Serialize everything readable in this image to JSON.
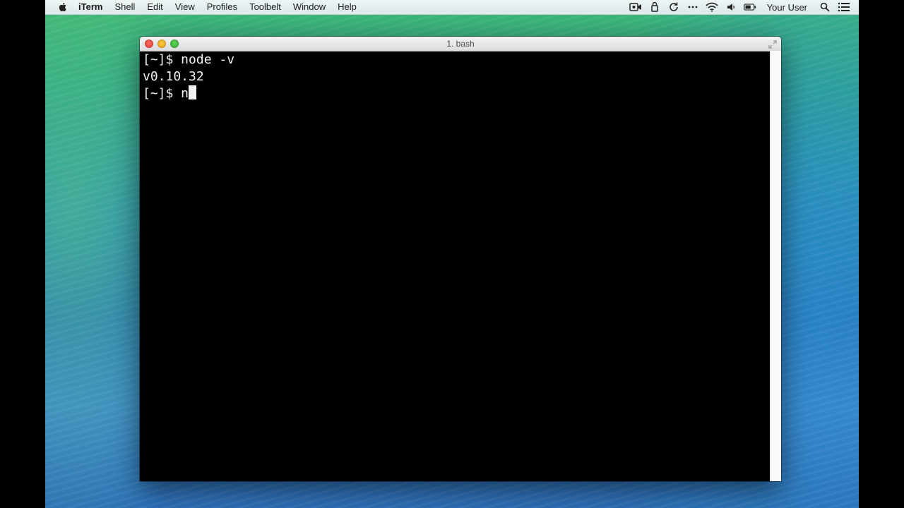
{
  "menubar": {
    "app_name": "iTerm",
    "menus": [
      "Shell",
      "Edit",
      "View",
      "Profiles",
      "Toolbelt",
      "Window",
      "Help"
    ],
    "user": "Your User",
    "status_icons": [
      "facetime-camera-icon",
      "time-machine-icon",
      "sync-icon",
      "more-icon",
      "wifi-icon",
      "volume-icon",
      "battery-icon",
      "spotlight-search-icon",
      "notification-center-icon"
    ]
  },
  "window": {
    "title": "1. bash",
    "lines": [
      "[~]$ node -v",
      "v0.10.32",
      "[~]$ n"
    ]
  },
  "colors": {
    "terminal_bg": "#000000",
    "terminal_fg": "#f2f2f2"
  }
}
